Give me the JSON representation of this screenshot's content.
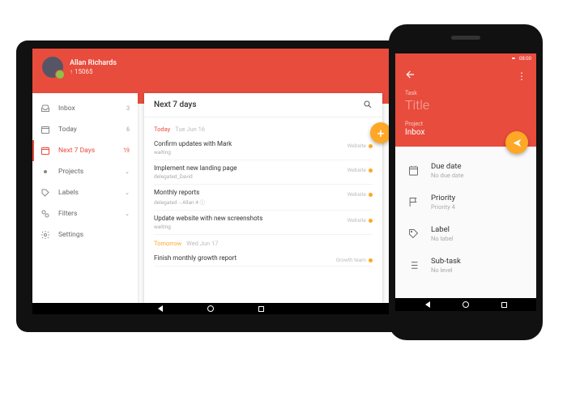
{
  "tablet": {
    "user": {
      "name": "Allan Richards",
      "karma": "↑ 15065"
    },
    "sidebar": {
      "items": [
        {
          "label": "Inbox",
          "count": "3"
        },
        {
          "label": "Today",
          "count": "6"
        },
        {
          "label": "Next 7 Days",
          "count": "19"
        },
        {
          "label": "Projects",
          "count": ""
        },
        {
          "label": "Labels",
          "count": ""
        },
        {
          "label": "Filters",
          "count": ""
        },
        {
          "label": "Settings",
          "count": ""
        }
      ]
    },
    "main": {
      "title": "Next 7 days",
      "today": {
        "label": "Today",
        "date": "Tue Jun 16"
      },
      "tomorrow": {
        "label": "Tomorrow",
        "date": "Wed Jun 17"
      },
      "tasks": [
        {
          "title": "Confirm updates with Mark",
          "sub": "waiting",
          "tag": "Website"
        },
        {
          "title": "Implement new landing page",
          "sub": "delegated_David",
          "tag": "Website"
        },
        {
          "title": "Monthly reports",
          "sub": "delegated→Allan\n4 ⓘ",
          "tag": "Website"
        },
        {
          "title": "Update website with new screenshots",
          "sub": "waiting",
          "tag": "Website"
        }
      ],
      "tasks_tomorrow": [
        {
          "title": "Finish monthly growth report",
          "sub": "",
          "tag": "Growth team"
        }
      ]
    }
  },
  "phone": {
    "status": {
      "time": "08:00"
    },
    "form": {
      "task_label": "Task",
      "title_placeholder": "Title",
      "project_label": "Project",
      "project_value": "Inbox"
    },
    "items": [
      {
        "label": "Due date",
        "value": "No due date"
      },
      {
        "label": "Priority",
        "value": "Priority 4"
      },
      {
        "label": "Label",
        "value": "No label"
      },
      {
        "label": "Sub-task",
        "value": "No level"
      }
    ]
  }
}
